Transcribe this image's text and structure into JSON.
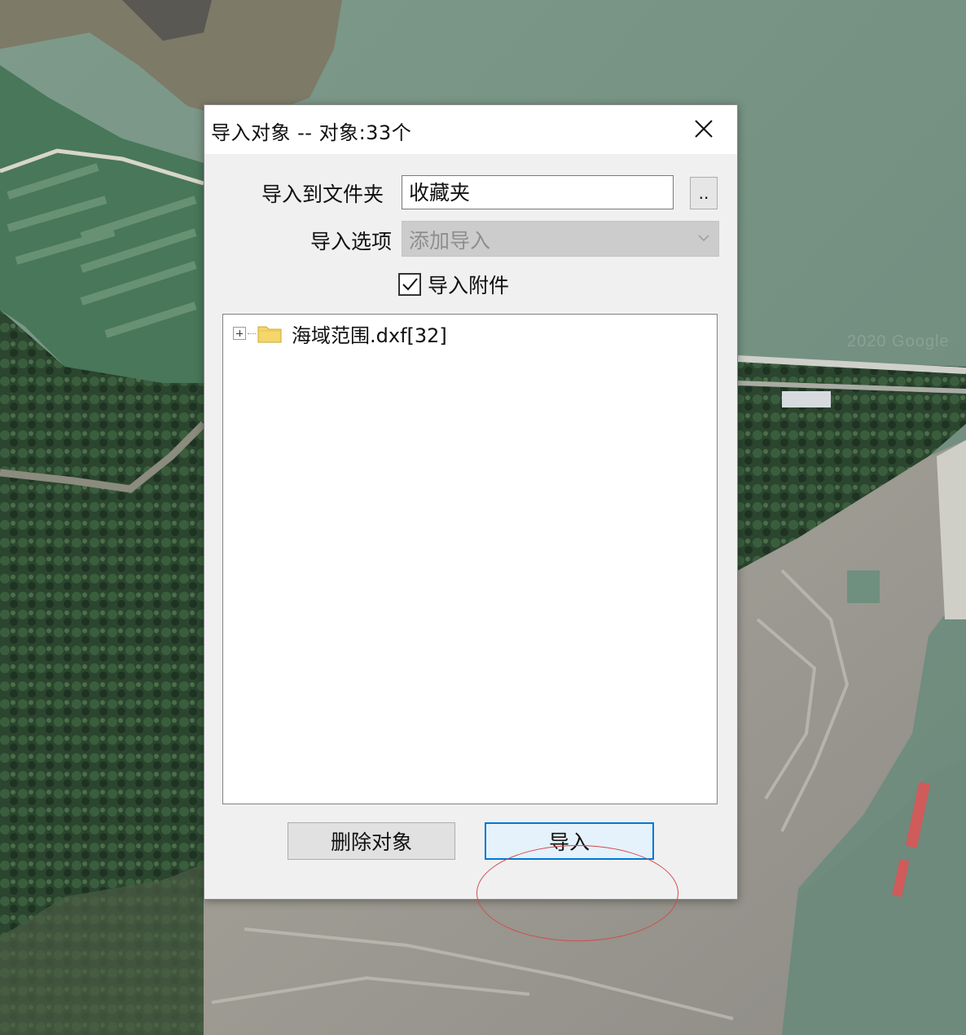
{
  "dialog": {
    "title": "导入对象 -- 对象:33个",
    "folder_label": "导入到文件夹",
    "folder_value": "收藏夹",
    "browse_label": "..",
    "option_label": "导入选项",
    "option_value": "添加导入",
    "option_disabled": true,
    "attach_label": "导入附件",
    "attach_checked": true,
    "tree": [
      {
        "name": "海域范围.dxf[32]",
        "icon": "folder-icon",
        "expanded": false
      }
    ],
    "delete_label": "删除对象",
    "import_label": "导入"
  },
  "colors": {
    "focus": "#0078d7",
    "annotation": "#d44a4a",
    "folder": "#f5d66b"
  }
}
